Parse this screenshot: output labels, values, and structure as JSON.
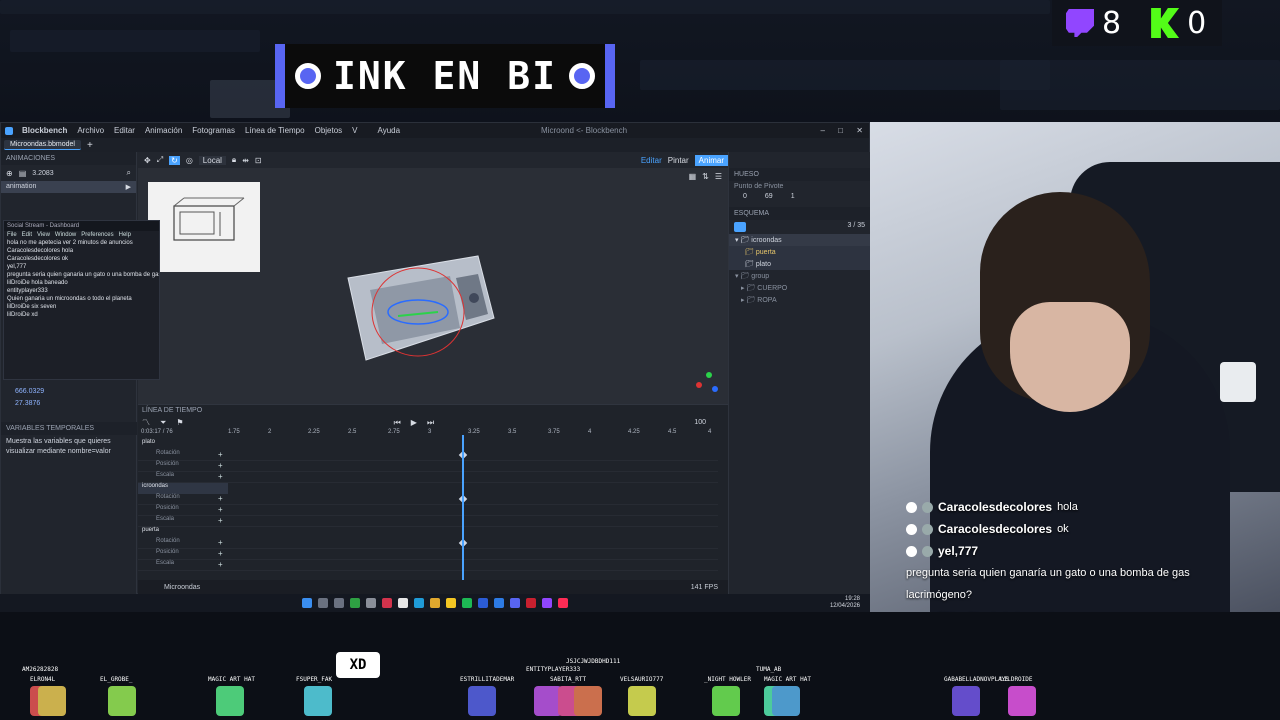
{
  "banner": {
    "text": "INK EN BI"
  },
  "counters": {
    "twitch_count": "8",
    "kick_count": "0"
  },
  "bb": {
    "app_name": "Blockbench",
    "menu": [
      "Archivo",
      "Editar",
      "Animación",
      "Fotogramas",
      "Línea de Tiempo",
      "Objetos",
      "V",
      "Ayuda"
    ],
    "window_title": "Microond <- Blockbench",
    "tab_label": "Microondas.bbmodel",
    "left": {
      "animaciones_header": "ANIMACIONES",
      "anim_value": "3.2083",
      "animation_item": "animation",
      "coord1": "666.0329",
      "coord2": "27.3876",
      "variables_header": "VARIABLES TEMPORALES",
      "variables_hint": "Muestra las variables que quieres visualizar mediante nombre=valor"
    },
    "toolbar": {
      "space": "Local"
    },
    "modes": {
      "edit": "Editar",
      "paint": "Pintar",
      "animate": "Animar"
    },
    "right": {
      "bone_header": "HUESO",
      "pivot_label": "Punto de Pivote",
      "pivot_values": [
        "0",
        "69",
        "1"
      ],
      "schema_header": "ESQUEMA",
      "schema_count": "3 / 35",
      "outliner": [
        {
          "name": "icroondas",
          "indent": 0
        },
        {
          "name": "puerta",
          "indent": 1
        },
        {
          "name": "plato",
          "indent": 1
        },
        {
          "name": "group",
          "indent": 0
        },
        {
          "name": "CUERPO",
          "indent": 1
        },
        {
          "name": "ROPA",
          "indent": 1
        }
      ]
    },
    "timeline": {
      "header": "LÍNEA DE TIEMPO",
      "time": "0:03:17",
      "frames": "/ 76",
      "ruler": [
        "1.75",
        "2",
        "2.25",
        "2.5",
        "2.75",
        "3",
        "3.25",
        "3.5",
        "3.75",
        "4",
        "4.25",
        "4.5",
        "4"
      ],
      "speed": "100",
      "groups": [
        {
          "name": "plato",
          "channels": [
            "Rotación",
            "Posición",
            "Escala"
          ]
        },
        {
          "name": "icroondas",
          "channels": [
            "Rotación",
            "Posición",
            "Escala"
          ]
        },
        {
          "name": "puerta",
          "channels": [
            "Rotación",
            "Posición",
            "Escala"
          ]
        }
      ]
    },
    "status": {
      "model": "Microondas",
      "fps": "141 FPS"
    },
    "clock": {
      "time": "19:28",
      "date": "12/04/2026"
    }
  },
  "mini_chat": {
    "title": "Social Stream - Dashboard",
    "menu": [
      "File",
      "Edit",
      "View",
      "Window",
      "Preferences",
      "Help"
    ],
    "rows": [
      "hola no me apetecia ver 2 minutos de anuncios",
      "Caracolesdecolores hola",
      "Caracolesdecolores ok",
      "yel,777",
      "pregunta seria quien ganaria un gato o una bomba de gas lacrimógeno?",
      "lilDroiDe hola baneado",
      "entityplayer333",
      "Quien ganaria un microondas o todo el planeta",
      "lilDroiDe six seven",
      "lilDroiDe xd"
    ]
  },
  "stream_chat": [
    {
      "name": "Caracolesdecolores",
      "msg": "hola",
      "platform": "tiktok"
    },
    {
      "name": "Caracolesdecolores",
      "msg": "ok",
      "platform": "tiktok"
    },
    {
      "name": "yel,777",
      "msg": "",
      "platform": "tiktok"
    },
    {
      "name": "",
      "msg": "pregunta seria quien ganaría un gato o una bomba de gas lacrimógeno?",
      "platform": ""
    },
    {
      "name": "lilDroiDe",
      "msg": "hola baneado",
      "platform": "tiktok"
    },
    {
      "name": "entityplayer333",
      "msg": "",
      "platform": "twitch"
    },
    {
      "name": "",
      "msg": "Quien ganaria un microondas o todo el planeta",
      "platform": ""
    },
    {
      "name": "lilDroiDe",
      "msg": "six seven",
      "platform": "tiktok"
    },
    {
      "name": "lilDroiDe",
      "msg": "xd",
      "platform": "tiktok"
    }
  ],
  "crowd": {
    "bubble": "XD",
    "names": [
      "AM26282828",
      "ELRON4L",
      "EL_GROBE_",
      "MAGIC ART HAT",
      "FSUPER_FAK",
      "ESTRILLITADEMAR",
      "ENTITYPLAYER333",
      "SABITA_RTT",
      "JSJCJWJDBDHD111",
      "VELSAURIO777",
      "_NIGHT HOWLER",
      "TUMA_AB",
      "MAGIC ART HAT",
      "GABABELLADNOVPLAYS",
      "LILDROIDE"
    ]
  },
  "colors": {
    "accent": "#4aa3ff",
    "twitch": "#9146ff",
    "kick": "#53fc18",
    "discord": "#5865f2"
  }
}
